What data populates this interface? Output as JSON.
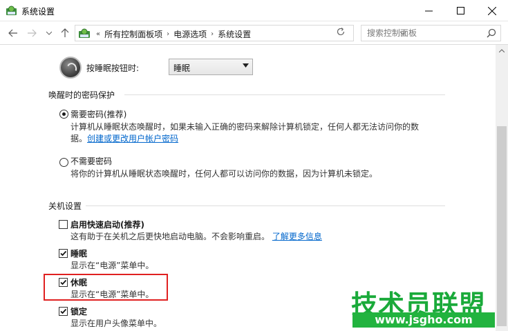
{
  "window": {
    "title": "系统设置"
  },
  "nav": {
    "breadcrumbs": [
      "所有控制面板项",
      "电源选项",
      "系统设置"
    ],
    "overflow": "«",
    "search_placeholder": "搜索控制面板"
  },
  "sleep_button": {
    "label": "按睡眠按钮时:",
    "value": "睡眠"
  },
  "wake_password": {
    "header": "唤醒时的密码保护",
    "require": {
      "label": "需要密码(推荐)",
      "desc_line1": "计算机从睡眠状态唤醒时，如果未输入正确的密码来解除计算机锁定，任何人都无法访问你的数",
      "desc_line2_prefix": "据。",
      "link": "创建或更改用户帐户密码",
      "selected": true
    },
    "no_require": {
      "label": "不需要密码",
      "desc": "将你的计算机从睡眠状态唤醒时，任何人都可以访问你的数据，因为计算机未锁定。",
      "selected": false
    }
  },
  "shutdown": {
    "header": "关机设置",
    "items": [
      {
        "label": "启用快速启动(推荐)",
        "desc": "这有助于在关机之后更快地启动电脑。不会影响重启。",
        "link": "了解更多信息",
        "checked": false
      },
      {
        "label": "睡眠",
        "desc": "显示在“电源”菜单中。",
        "checked": true
      },
      {
        "label": "休眠",
        "desc": "显示在“电源”菜单中。",
        "checked": true
      },
      {
        "label": "锁定",
        "desc": "显示在用户头像菜单中。",
        "checked": true
      }
    ]
  },
  "watermark": {
    "name": "技术员联盟",
    "url": "www.jsgho.com"
  }
}
